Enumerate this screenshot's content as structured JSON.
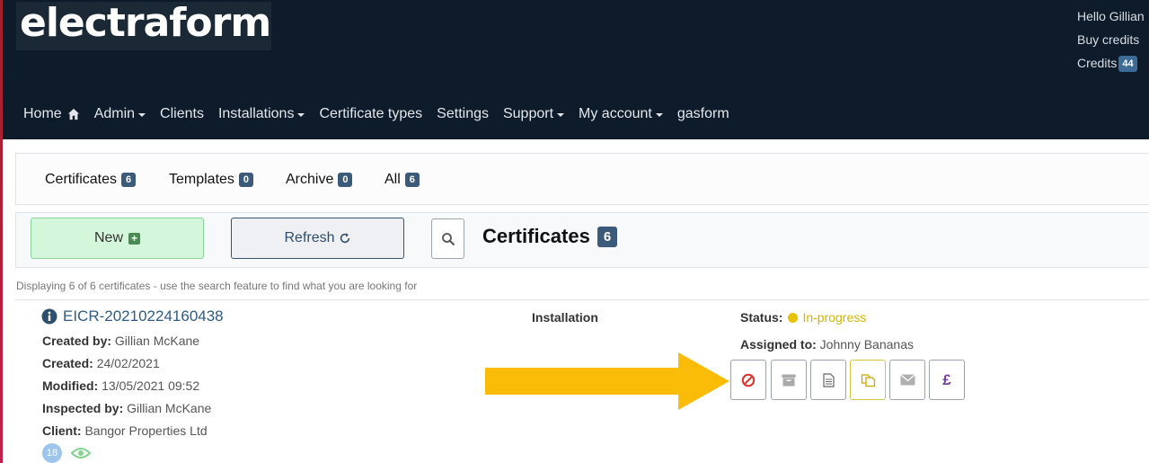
{
  "app": {
    "logo_text": "electraform"
  },
  "user": {
    "greeting": "Hello Gillian",
    "buy_credits": "Buy credits",
    "credits_label": "Credits",
    "credits_count": "44"
  },
  "nav": {
    "items": [
      {
        "label": "Home",
        "icon": "home-icon",
        "dropdown": false
      },
      {
        "label": "Admin",
        "dropdown": true
      },
      {
        "label": "Clients",
        "dropdown": false
      },
      {
        "label": "Installations",
        "dropdown": true
      },
      {
        "label": "Certificate types",
        "dropdown": false
      },
      {
        "label": "Settings",
        "dropdown": false
      },
      {
        "label": "Support",
        "dropdown": true
      },
      {
        "label": "My account",
        "dropdown": true
      },
      {
        "label": "gasform",
        "dropdown": false
      }
    ]
  },
  "tabs": [
    {
      "label": "Certificates",
      "count": "6"
    },
    {
      "label": "Templates",
      "count": "0"
    },
    {
      "label": "Archive",
      "count": "0"
    },
    {
      "label": "All",
      "count": "6"
    }
  ],
  "actions": {
    "new_label": "New",
    "refresh_label": "Refresh",
    "heading": "Certificates",
    "heading_count": "6"
  },
  "display_note": "Displaying 6 of 6 certificates - use the search feature to find what you are looking for",
  "certificate": {
    "id": "EICR-20210224160438",
    "created_by_label": "Created by:",
    "created_by": "Gillian McKane",
    "created_label": "Created:",
    "created": "24/02/2021",
    "modified_label": "Modified:",
    "modified": "13/05/2021 09:52",
    "inspected_by_label": "Inspected by:",
    "inspected_by": "Gillian McKane",
    "client_label": "Client:",
    "client": "Bangor Properties Ltd",
    "badge_number": "18",
    "installation_label": "Installation",
    "status_label": "Status:",
    "status": "In-progress",
    "assigned_label": "Assigned to:",
    "assigned_to": "Johnny Bananas",
    "pound_symbol": "£"
  },
  "colors": {
    "header_bg": "#0d1b2a",
    "badge": "#3c5a7a",
    "status_yellow": "#d4b400",
    "arrow": "#fbbc08",
    "new_button_bg": "#d4f7dc"
  }
}
